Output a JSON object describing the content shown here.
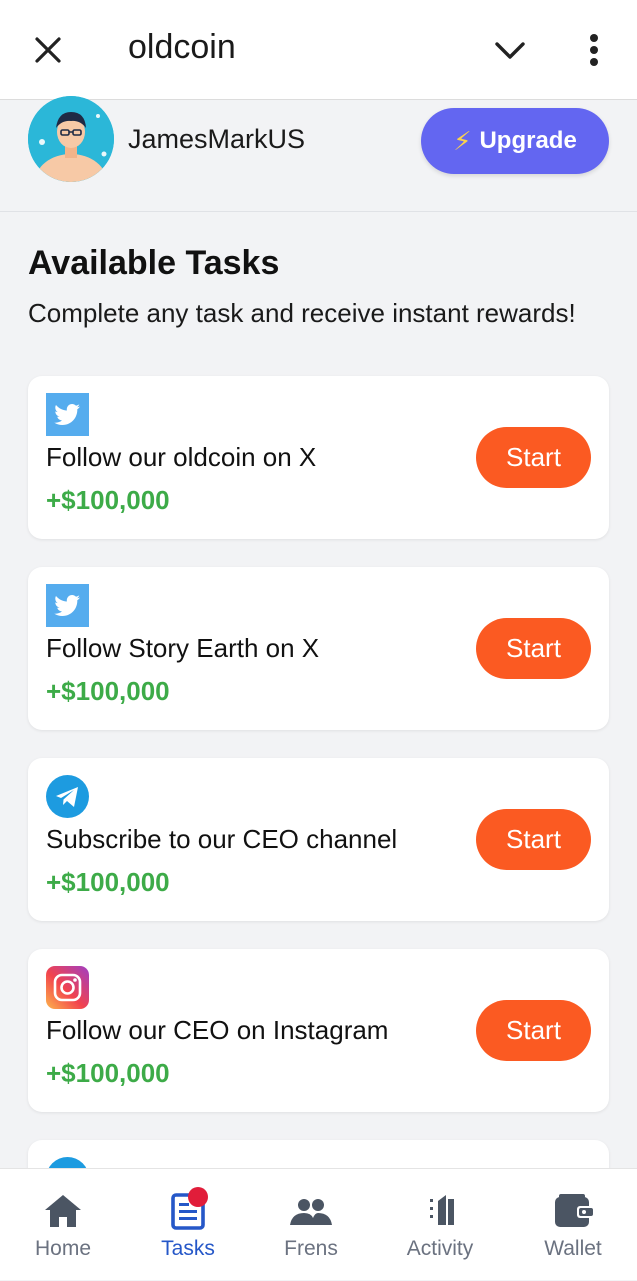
{
  "topbar": {
    "title": "oldcoin"
  },
  "profile": {
    "username": "JamesMarkUS",
    "upgrade_label": "Upgrade"
  },
  "tasks_section": {
    "heading": "Available Tasks",
    "subtitle": "Complete any task and receive instant rewards!"
  },
  "tasks": [
    {
      "icon": "twitter-icon",
      "label": "Follow our oldcoin on X",
      "reward": "+$100,000",
      "button": "Start"
    },
    {
      "icon": "twitter-icon",
      "label": "Follow Story Earth on X",
      "reward": "+$100,000",
      "button": "Start"
    },
    {
      "icon": "telegram-icon",
      "label": "Subscribe to our CEO channel",
      "reward": "+$100,000",
      "button": "Start"
    },
    {
      "icon": "instagram-icon",
      "label": "Follow our CEO on Instagram",
      "reward": "+$100,000",
      "button": "Start"
    }
  ],
  "nav": [
    {
      "label": "Home",
      "icon": "home-icon",
      "active": false
    },
    {
      "label": "Tasks",
      "icon": "tasks-icon",
      "active": true
    },
    {
      "label": "Frens",
      "icon": "friends-icon",
      "active": false
    },
    {
      "label": "Activity",
      "icon": "activity-icon",
      "active": false
    },
    {
      "label": "Wallet",
      "icon": "wallet-icon",
      "active": false
    }
  ],
  "colors": {
    "accent_purple": "#6366f1",
    "start_orange": "#fb5a22",
    "reward_green": "#3dab48",
    "nav_active": "#2557c8"
  }
}
